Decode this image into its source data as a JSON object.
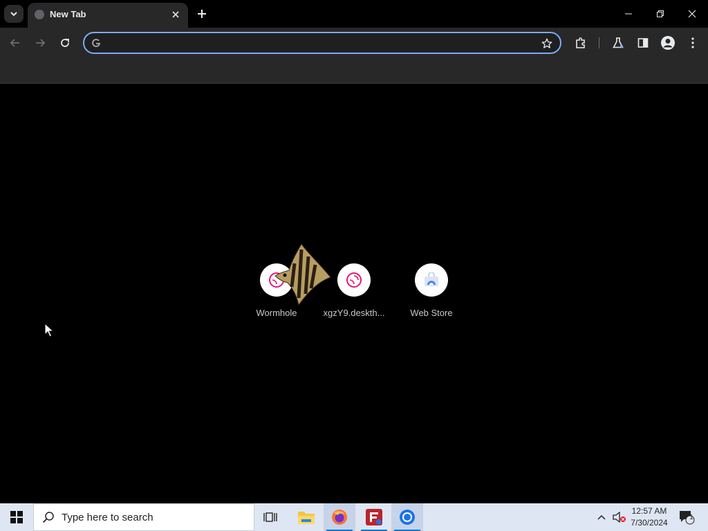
{
  "browser": {
    "tab": {
      "title": "New Tab"
    },
    "omnibox": {
      "value": "",
      "placeholder": ""
    }
  },
  "shortcuts": [
    {
      "label": "Wormhole",
      "icon": "wormhole-icon"
    },
    {
      "label": "xgzY9.deskth...",
      "icon": "wormhole-icon"
    },
    {
      "label": "Web Store",
      "icon": "web-store-icon"
    }
  ],
  "taskbar": {
    "search_placeholder": "Type here to search",
    "clock_time": "12:57 AM",
    "clock_date": "7/30/2024",
    "notification_count": "1"
  },
  "colors": {
    "accent": "#7cacf8",
    "taskbar_bg": "#dfe6f3",
    "wormhole_pink": "#e4177b"
  }
}
